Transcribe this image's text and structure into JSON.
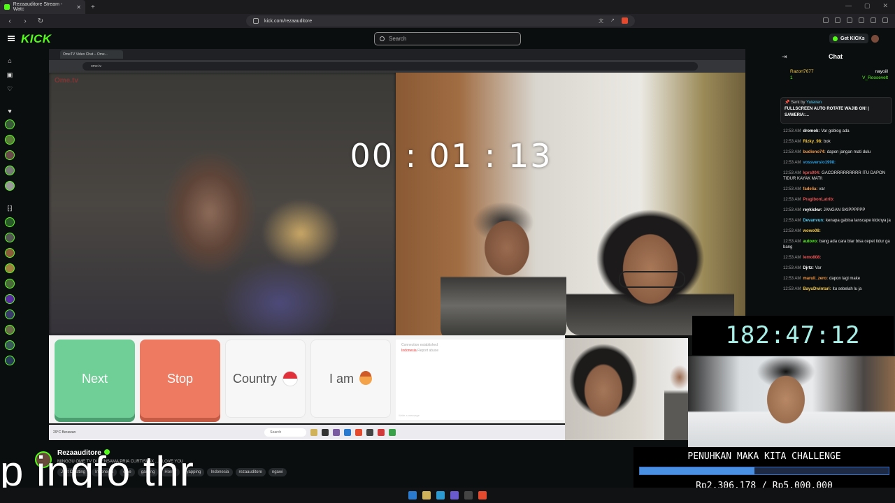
{
  "browser": {
    "tab_title": "Rezaauditore Stream - Watc",
    "url": "kick.com/rezaauditore"
  },
  "kick": {
    "logo": "KICK",
    "search_placeholder": "Search",
    "get_kicks": "Get KICKs",
    "download_banner": "Download this video"
  },
  "inner_browser": {
    "tab_title": "OmeTV Video Chat – Ome...",
    "url": "ome.tv"
  },
  "ome": {
    "logo": "Ome.tv",
    "timer": "00 : 01 : 13",
    "next_label": "Next",
    "stop_label": "Stop",
    "country_label": "Country",
    "iam_label": "I am",
    "chat_status": "Connection established",
    "chat_country": "Indonesia",
    "chat_report": "Report abuse",
    "chat_input_placeholder": "Write a message",
    "taskbar_weather": "29°C Berawan",
    "taskbar_search": "Search"
  },
  "chat": {
    "title": "Chat",
    "gifters": [
      {
        "name": "Razort7677",
        "count": "1",
        "color": "#f2c94c"
      },
      {
        "name": "nayoiil",
        "count": "1",
        "color": "#ffffff"
      },
      {
        "name": "V_Roosevelt",
        "count": "1",
        "color": "#53fc18"
      }
    ],
    "pinned_sent_by": "Sent by",
    "pinned_user": "Yuteiren",
    "pinned_text": "FULLSCREEN AUTO ROTATE WAJIB ON! | SAWERIA:...",
    "messages": [
      {
        "time": "12:53 AM",
        "user": "dromok:",
        "text": "Var goblog ada",
        "color": "#ffffff"
      },
      {
        "time": "12:53 AM",
        "user": "Rizky_98:",
        "text": "bok",
        "color": "#f2c94c"
      },
      {
        "time": "12:53 AM",
        "user": "budiono74:",
        "text": "dapon jangan mati dulu",
        "color": "#f2994a"
      },
      {
        "time": "12:53 AM",
        "user": "vossversio1998:",
        "text": "",
        "color": "#2d9cdb"
      },
      {
        "time": "12:53 AM",
        "user": "kprs004:",
        "text": "GACORRRRRRRRR ITU DAPON TIDUR KAYAK MATI\\",
        "color": "#eb5757"
      },
      {
        "time": "12:53 AM",
        "user": "fadelia:",
        "text": "var",
        "color": "#f2994a"
      },
      {
        "time": "12:53 AM",
        "user": "PragibonLatrib:",
        "text": "",
        "color": "#eb5757"
      },
      {
        "time": "12:53 AM",
        "user": "reykickw:",
        "text": "JANGAN SKIPPPPPP",
        "color": "#ffffff"
      },
      {
        "time": "12:53 AM",
        "user": "Devanvun:",
        "text": "kenapa gabisa lanscape kicknya ja",
        "color": "#56ccf2"
      },
      {
        "time": "12:53 AM",
        "user": "wowo08:",
        "text": "",
        "color": "#f2c94c"
      },
      {
        "time": "12:53 AM",
        "user": "autovo:",
        "text": "bang ada cara biar bisa cepet tidur ga bang",
        "color": "#53fc18"
      },
      {
        "time": "12:53 AM",
        "user": "lemo808:",
        "text": "",
        "color": "#eb5757"
      },
      {
        "time": "12:53 AM",
        "user": "Djrtz:",
        "text": "Var",
        "color": "#ffffff"
      },
      {
        "time": "12:53 AM",
        "user": "maruli_zero:",
        "text": "dapon lagi make",
        "color": "#f2994a"
      },
      {
        "time": "12:53 AM",
        "user": "BayuDwintari:",
        "text": "itu sebelah lu ja",
        "color": "#f2c94c"
      }
    ]
  },
  "overlay": {
    "timer": "182:47:12",
    "challenge_title": "PENUHKAN MAKA KITA CHALLENGE",
    "challenge_amount": "Rp2.306.178 / Rp5.000.000",
    "challenge_progress": 0.461
  },
  "stream": {
    "streamer": "Rezaauditore",
    "title": "MINGGU OME TV DI BENSAMA PRIA CURTISLAX ... I LOVE YOU",
    "tags": [
      "Just Chatting",
      "Indonesia",
      "ome",
      "gaming",
      "Horror",
      "yapping",
      "Indonesia",
      "rezaauditore",
      "ngawi"
    ],
    "caption": "p ingfo thr"
  },
  "colors": {
    "kick_green": "#53fc18",
    "next": "#6fcf97",
    "stop": "#ee7a62",
    "timer_overlay": "#a6f0e8"
  }
}
